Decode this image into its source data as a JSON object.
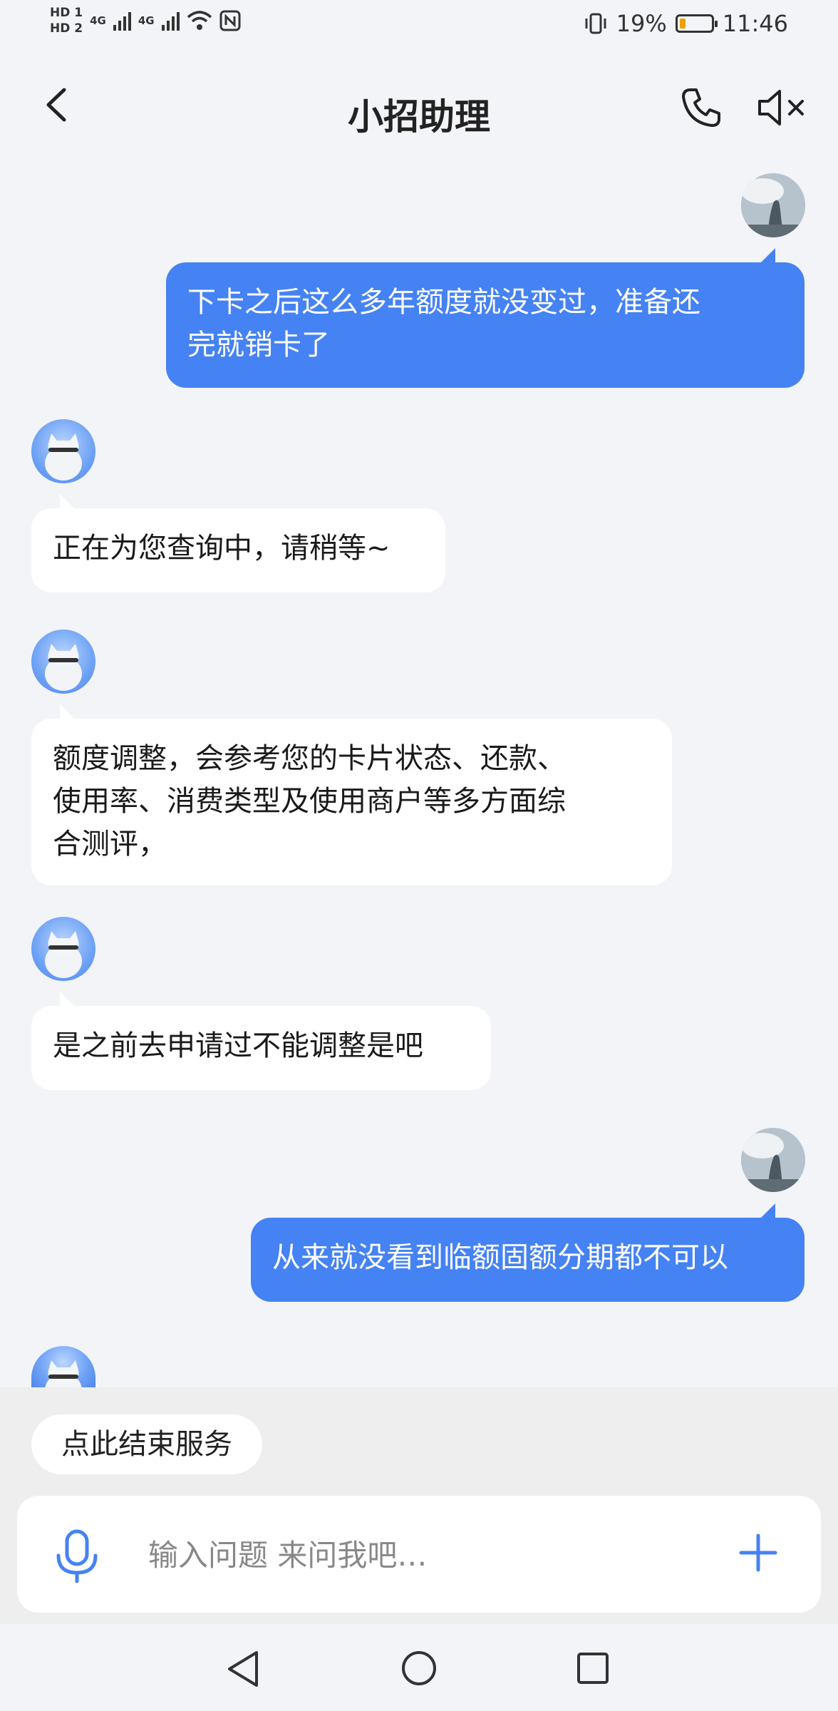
{
  "status_bar": {
    "hd1": "HD 1",
    "hd2": "HD 2",
    "net1": "4G",
    "net2": "4G",
    "battery": "19%",
    "time": "11:46"
  },
  "header": {
    "title": "小招助理",
    "icons": {
      "back": "chevron-left-icon",
      "call": "phone-icon",
      "mute": "speaker-muted-icon"
    }
  },
  "messages": [
    {
      "from": "user",
      "text_lines": [
        "下卡之后这么多年额度就没变过，准备还",
        "完就销卡了"
      ]
    },
    {
      "from": "assistant",
      "text_lines": [
        "正在为您查询中，请稍等~"
      ]
    },
    {
      "from": "assistant",
      "text_lines": [
        "额度调整，会参考您的卡片状态、还款、",
        "使用率、消费类型及使用商户等多方面综",
        "合测评，"
      ]
    },
    {
      "from": "assistant",
      "text_lines": [
        "是之前去申请过不能调整是吧"
      ]
    },
    {
      "from": "user",
      "text_lines": [
        "从来就没看到临额固额分期都不可以"
      ]
    }
  ],
  "footer": {
    "end_service": "点此结束服务",
    "input_placeholder": "输入问题 来问我吧…",
    "colors": {
      "accent": "#4582f3"
    }
  }
}
